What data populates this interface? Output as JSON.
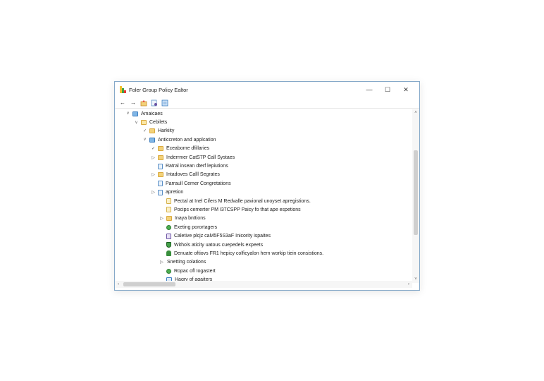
{
  "window": {
    "title": "Foler Group Policy Ealtor",
    "controls": {
      "minimize": "—",
      "maximize": "☐",
      "close": "✕"
    },
    "app_icon_colors": [
      "#f2c12e",
      "#43a047",
      "#e53935"
    ]
  },
  "toolbar": {
    "back": "←",
    "forward": "→"
  },
  "tree": {
    "rows": [
      {
        "indent": 0,
        "toggle": "v",
        "icon": "computer",
        "label": "Amaicaes"
      },
      {
        "indent": 1,
        "toggle": "v",
        "icon": "folder-open",
        "label": "Cebilets"
      },
      {
        "indent": 2,
        "toggle": "✓",
        "icon": "folder",
        "label": "Harkiity"
      },
      {
        "indent": 2,
        "toggle": "v",
        "icon": "computer",
        "label": "Anticcreton and applcation"
      },
      {
        "indent": 3,
        "toggle": "✓",
        "icon": "folder",
        "label": "Eceabome dfillaries"
      },
      {
        "indent": 3,
        "toggle": "▷",
        "icon": "folder",
        "label": "Inderrmer CatS7P Call Systaes"
      },
      {
        "indent": 3,
        "toggle": "",
        "icon": "settings-file",
        "label": "Ratral insean dterf lepiutions"
      },
      {
        "indent": 3,
        "toggle": "▷",
        "icon": "folder",
        "label": "Intadoves Calll Segrates"
      },
      {
        "indent": 3,
        "toggle": "",
        "icon": "settings-file",
        "label": "Parraull Cemer Congretations"
      },
      {
        "indent": 3,
        "toggle": "▷",
        "icon": "settings-file",
        "label": "apretion"
      },
      {
        "indent": 4,
        "toggle": "",
        "icon": "policy-file",
        "label": "Pectal at Inel Cifers M Redvalle pavional unoyset apregistions."
      },
      {
        "indent": 4,
        "toggle": "",
        "icon": "policy-file",
        "label": "Pocips cemerter PM I37CSPP Paicy fo that ape espetions"
      },
      {
        "indent": 4,
        "toggle": "▷",
        "icon": "folder",
        "label": "Inaya bnttions"
      },
      {
        "indent": 4,
        "toggle": "",
        "icon": "green-gear",
        "label": "Exeting porortagers"
      },
      {
        "indent": 4,
        "toggle": "",
        "icon": "pen-doc",
        "label": "Caletive plcjz caM5F5S3aF Inicority ispaites"
      },
      {
        "indent": 4,
        "toggle": "",
        "icon": "shield",
        "label": "Withols aticity uatous cuepedels expeets"
      },
      {
        "indent": 4,
        "toggle": "",
        "icon": "person",
        "label": "Denuate oftiovs FR1 hepicy colficyalon hern workip tiein consistions."
      },
      {
        "indent": 4,
        "toggle": "▷",
        "icon": "",
        "label": "Snetting colations"
      },
      {
        "indent": 4,
        "toggle": "",
        "icon": "green-gear",
        "label": "Ropac ofl Iogastert"
      },
      {
        "indent": 4,
        "toggle": "",
        "icon": "blue-doc",
        "label": "Hagry of agaiters"
      }
    ]
  },
  "scrollbars": {
    "up": "˄",
    "down": "˅",
    "left": "‹",
    "right": "›"
  }
}
